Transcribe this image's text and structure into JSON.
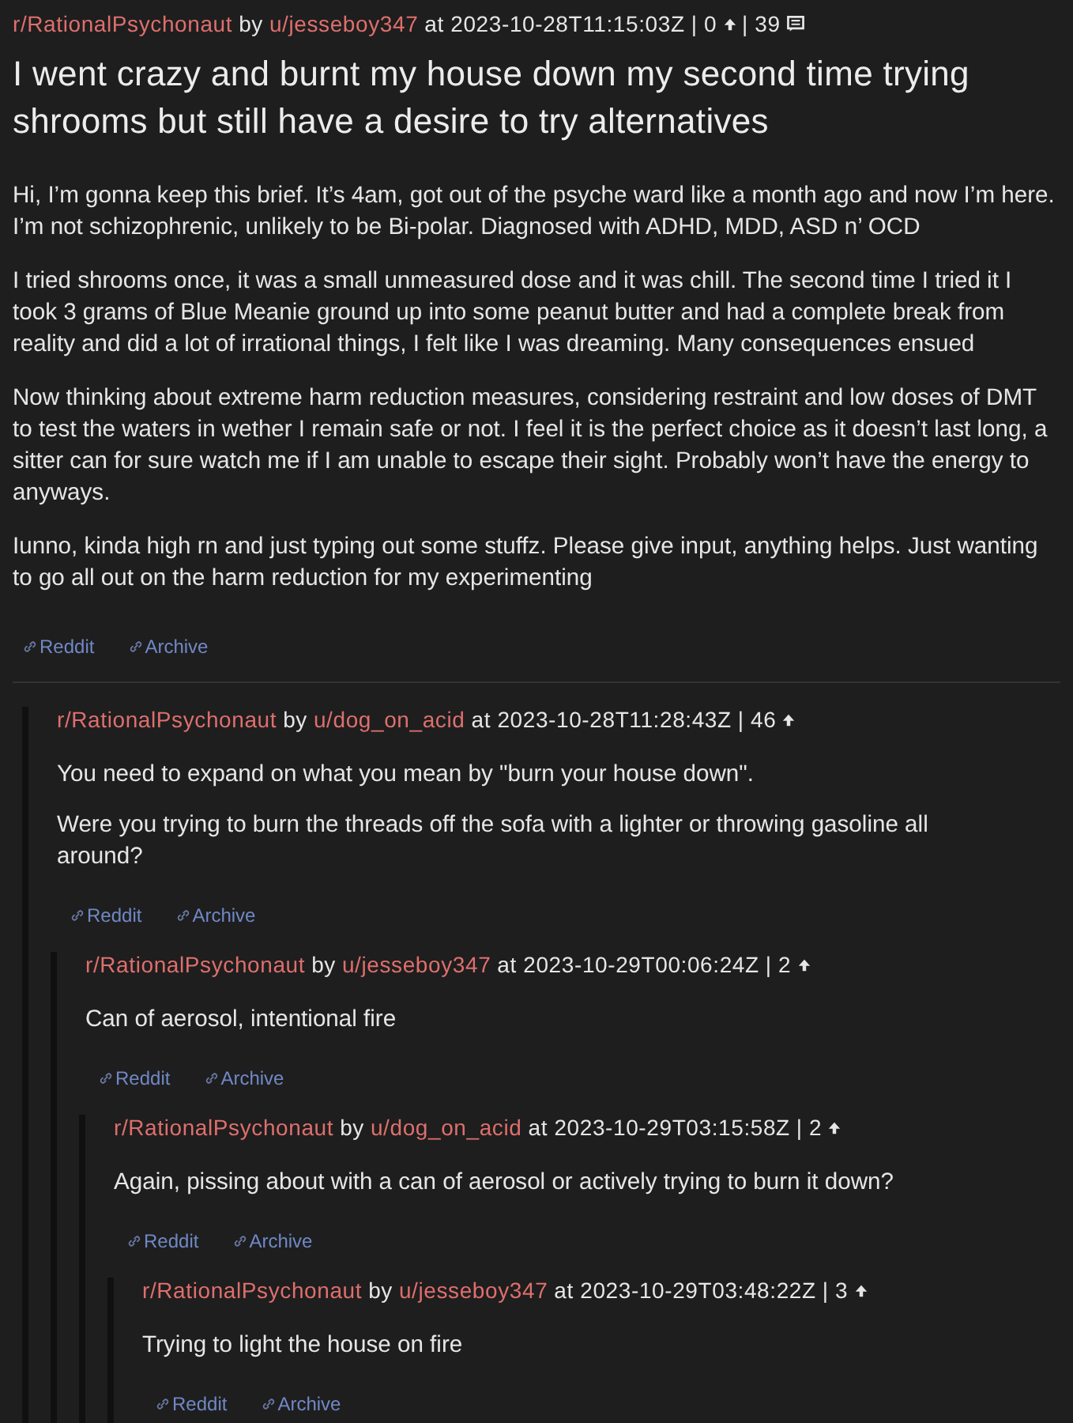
{
  "post": {
    "meta": {
      "subreddit": "r/RationalPsychonaut",
      "by": "by",
      "author": "u/jesseboy347",
      "timestamp": "at 2023-10-28T11:15:03Z",
      "score": "| 0",
      "comment_count": "| 39"
    },
    "title": "I went crazy and burnt my house down my second time trying shrooms but still have a desire to try alternatives",
    "body": [
      "Hi, I’m gonna keep this brief. It’s 4am, got out of the psyche ward like a month ago and now I’m here. I’m not schizophrenic, unlikely to be Bi-polar. Diagnosed with ADHD, MDD, ASD n’ OCD",
      "I tried shrooms once, it was a small unmeasured dose and it was chill. The second time I tried it I took 3 grams of Blue Meanie ground up into some peanut butter and had a complete break from reality and did a lot of irrational things, I felt like I was dreaming. Many consequences ensued",
      "Now thinking about extreme harm reduction measures, considering restraint and low doses of DMT to test the waters in wether I remain safe or not. I feel it is the perfect choice as it doesn’t last long, a sitter can for sure watch me if I am unable to escape their sight. Probably won’t have the energy to anyways.",
      "Iunno, kinda high rn and just typing out some stuffz. Please give input, anything helps. Just wanting to go all out on the harm reduction for my experimenting"
    ],
    "links": [
      {
        "label": "Reddit"
      },
      {
        "label": "Archive"
      }
    ]
  },
  "comments": [
    {
      "meta": {
        "subreddit": "r/RationalPsychonaut",
        "by": "by",
        "author": "u/dog_on_acid",
        "timestamp": "at 2023-10-28T11:28:43Z",
        "score": "| 46"
      },
      "body": [
        "You need to expand on what you mean by \"burn your house down\".",
        "Were you trying to burn the threads off the sofa with a lighter or throwing gasoline all around?"
      ],
      "links": [
        {
          "label": "Reddit"
        },
        {
          "label": "Archive"
        }
      ],
      "children": [
        {
          "meta": {
            "subreddit": "r/RationalPsychonaut",
            "by": "by",
            "author": "u/jesseboy347",
            "timestamp": "at 2023-10-29T00:06:24Z",
            "score": "| 2"
          },
          "body": [
            "Can of aerosol, intentional fire"
          ],
          "links": [
            {
              "label": "Reddit"
            },
            {
              "label": "Archive"
            }
          ],
          "children": [
            {
              "meta": {
                "subreddit": "r/RationalPsychonaut",
                "by": "by",
                "author": "u/dog_on_acid",
                "timestamp": "at 2023-10-29T03:15:58Z",
                "score": "| 2"
              },
              "body": [
                "Again, pissing about with a can of aerosol or actively trying to burn it down?"
              ],
              "links": [
                {
                  "label": "Reddit"
                },
                {
                  "label": "Archive"
                }
              ],
              "children": [
                {
                  "meta": {
                    "subreddit": "r/RationalPsychonaut",
                    "by": "by",
                    "author": "u/jesseboy347",
                    "timestamp": "at 2023-10-29T03:48:22Z",
                    "score": "| 3"
                  },
                  "body": [
                    "Trying to light the house on fire"
                  ],
                  "links": [
                    {
                      "label": "Reddit"
                    },
                    {
                      "label": "Archive"
                    }
                  ]
                }
              ]
            }
          ]
        }
      ]
    }
  ]
}
